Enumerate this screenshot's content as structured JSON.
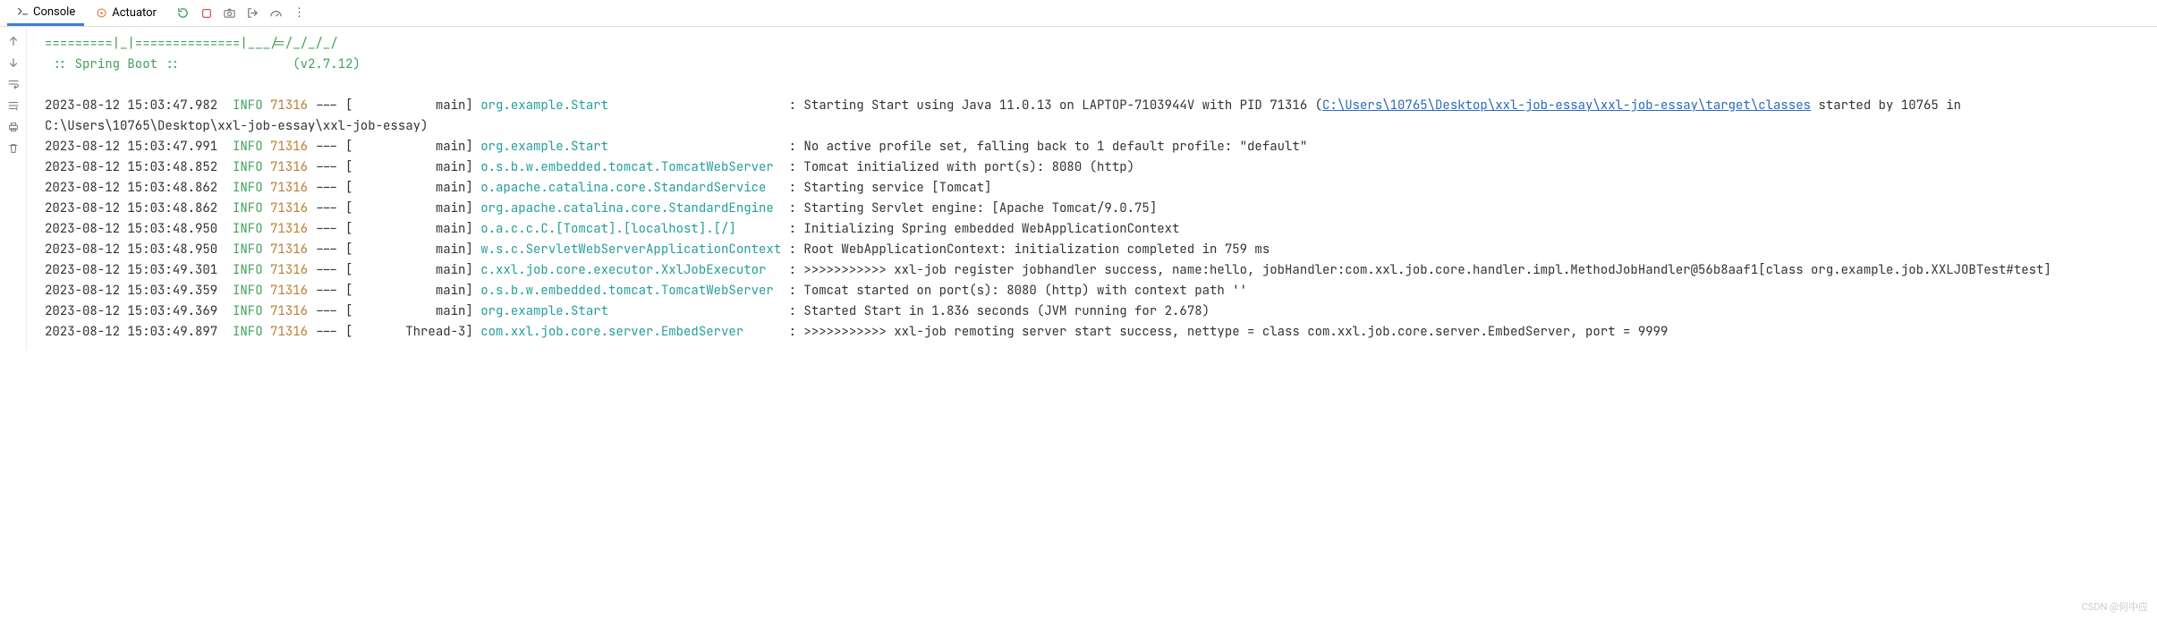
{
  "tabs": {
    "console": "Console",
    "actuator": "Actuator"
  },
  "ascii": {
    "line1": "=========|_|==============|___/=/_/_/_/",
    "line2": " :: Spring Boot ::               (v2.7.12)"
  },
  "link": "C:\\Users\\10765\\Desktop\\xxl-job-essay\\xxl-job-essay\\target\\classes",
  "log": [
    {
      "ts": "2023-08-12 15:03:47.982",
      "lvl": "INFO",
      "pid": "71316",
      "sep": "---",
      "thread": "[           main]",
      "logger": "org.example.Start",
      "colon": ": ",
      "msg1": "Starting Start using Java 11.0.13 on LAPTOP-7103944V with PID 71316 (",
      "msg2": " started by 10765 in C:\\Users\\10765\\Desktop\\xxl-job-essay\\xxl-job-essay)"
    },
    {
      "ts": "2023-08-12 15:03:47.991",
      "lvl": "INFO",
      "pid": "71316",
      "sep": "---",
      "thread": "[           main]",
      "logger": "org.example.Start",
      "colon": ": ",
      "msg": "No active profile set, falling back to 1 default profile: \"default\""
    },
    {
      "ts": "2023-08-12 15:03:48.852",
      "lvl": "INFO",
      "pid": "71316",
      "sep": "---",
      "thread": "[           main]",
      "logger": "o.s.b.w.embedded.tomcat.TomcatWebServer",
      "colon": ": ",
      "msg": "Tomcat initialized with port(s): 8080 (http)"
    },
    {
      "ts": "2023-08-12 15:03:48.862",
      "lvl": "INFO",
      "pid": "71316",
      "sep": "---",
      "thread": "[           main]",
      "logger": "o.apache.catalina.core.StandardService",
      "colon": ": ",
      "msg": "Starting service [Tomcat]"
    },
    {
      "ts": "2023-08-12 15:03:48.862",
      "lvl": "INFO",
      "pid": "71316",
      "sep": "---",
      "thread": "[           main]",
      "logger": "org.apache.catalina.core.StandardEngine",
      "colon": ": ",
      "msg": "Starting Servlet engine: [Apache Tomcat/9.0.75]"
    },
    {
      "ts": "2023-08-12 15:03:48.950",
      "lvl": "INFO",
      "pid": "71316",
      "sep": "---",
      "thread": "[           main]",
      "logger": "o.a.c.c.C.[Tomcat].[localhost].[/]",
      "colon": ": ",
      "msg": "Initializing Spring embedded WebApplicationContext"
    },
    {
      "ts": "2023-08-12 15:03:48.950",
      "lvl": "INFO",
      "pid": "71316",
      "sep": "---",
      "thread": "[           main]",
      "logger": "w.s.c.ServletWebServerApplicationContext",
      "colon": ": ",
      "msg": "Root WebApplicationContext: initialization completed in 759 ms"
    },
    {
      "ts": "2023-08-12 15:03:49.301",
      "lvl": "INFO",
      "pid": "71316",
      "sep": "---",
      "thread": "[           main]",
      "logger": "c.xxl.job.core.executor.XxlJobExecutor",
      "colon": ": ",
      "msg": ">>>>>>>>>>> xxl-job register jobhandler success, name:hello, jobHandler:com.xxl.job.core.handler.impl.MethodJobHandler@56b8aaf1[class org.example.job.XXLJOBTest#test]"
    },
    {
      "ts": "2023-08-12 15:03:49.359",
      "lvl": "INFO",
      "pid": "71316",
      "sep": "---",
      "thread": "[           main]",
      "logger": "o.s.b.w.embedded.tomcat.TomcatWebServer",
      "colon": ": ",
      "msg": "Tomcat started on port(s): 8080 (http) with context path ''"
    },
    {
      "ts": "2023-08-12 15:03:49.369",
      "lvl": "INFO",
      "pid": "71316",
      "sep": "---",
      "thread": "[           main]",
      "logger": "org.example.Start",
      "colon": ": ",
      "msg": "Started Start in 1.836 seconds (JVM running for 2.678)"
    },
    {
      "ts": "2023-08-12 15:03:49.897",
      "lvl": "INFO",
      "pid": "71316",
      "sep": "---",
      "thread": "[       Thread-3]",
      "logger": "com.xxl.job.core.server.EmbedServer",
      "colon": ": ",
      "msg": ">>>>>>>>>>> xxl-job remoting server start success, nettype = class com.xxl.job.core.server.EmbedServer, port = 9999"
    }
  ],
  "watermark": "CSDN @何中应"
}
